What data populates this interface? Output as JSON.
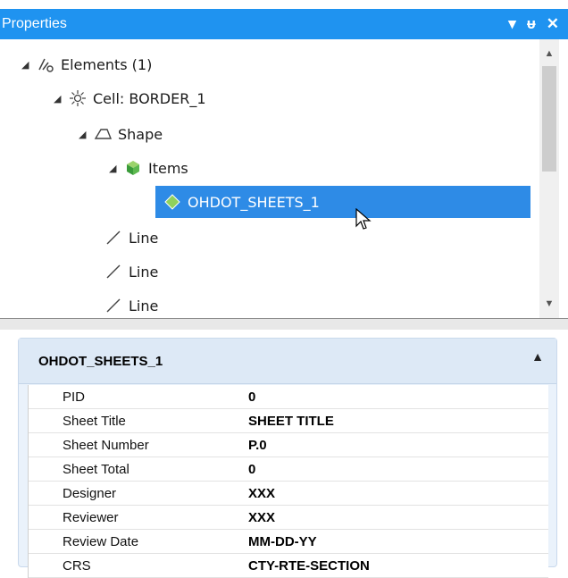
{
  "window": {
    "title": "Properties",
    "controls": {
      "dropdown_icon": "chevron-down-icon",
      "pin_icon": "pin-icon",
      "close_icon": "close-icon"
    }
  },
  "tree": {
    "nodes": [
      {
        "label": "Elements (1)",
        "icon": "elements-icon",
        "expanded": true
      },
      {
        "label": "Cell: BORDER_1",
        "icon": "cell-icon",
        "expanded": true
      },
      {
        "label": "Shape",
        "icon": "shape-icon",
        "expanded": true
      },
      {
        "label": "Items",
        "icon": "items-icon",
        "expanded": true
      },
      {
        "label": "OHDOT_SHEETS_1",
        "icon": "item-diamond-icon",
        "selected": true
      },
      {
        "label": "Line",
        "icon": "line-icon"
      },
      {
        "label": "Line",
        "icon": "line-icon"
      },
      {
        "label": "Line",
        "icon": "line-icon"
      }
    ]
  },
  "details": {
    "header": "OHDOT_SHEETS_1",
    "rows": [
      {
        "key": "PID",
        "value": "0"
      },
      {
        "key": "Sheet Title",
        "value": "SHEET TITLE"
      },
      {
        "key": "Sheet Number",
        "value": "P.0"
      },
      {
        "key": "Sheet Total",
        "value": "0"
      },
      {
        "key": "Designer",
        "value": "XXX"
      },
      {
        "key": "Reviewer",
        "value": "XXX"
      },
      {
        "key": "Review Date",
        "value": "MM-DD-YY"
      },
      {
        "key": "CRS",
        "value": "CTY-RTE-SECTION"
      }
    ]
  },
  "colors": {
    "titlebar": "#1f93f0",
    "selection": "#2e8be6",
    "panel_bg": "#eaf2fb"
  }
}
